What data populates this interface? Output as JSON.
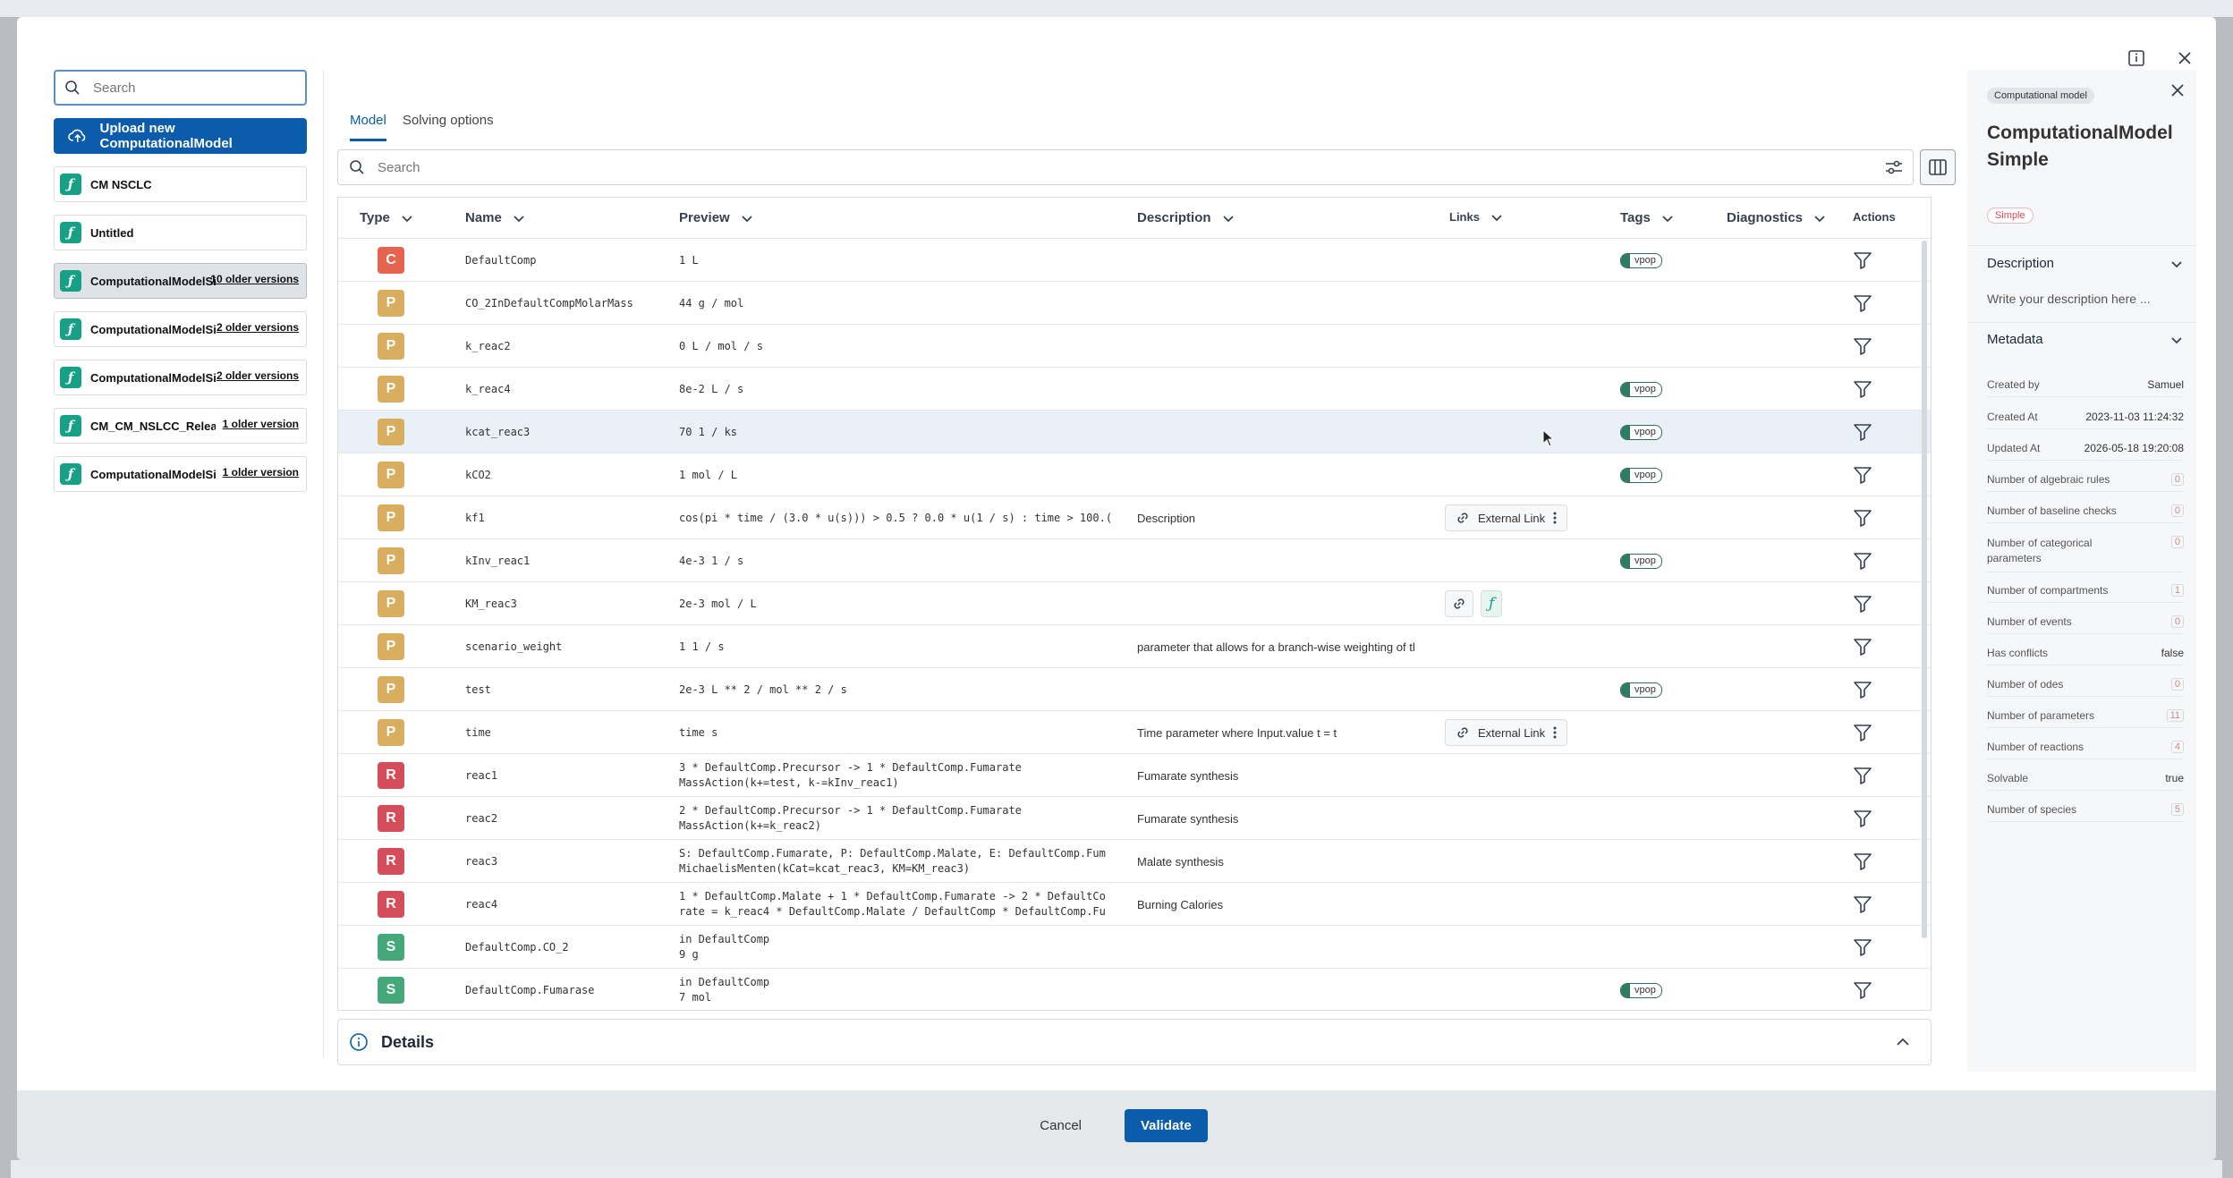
{
  "left_panel": {
    "search_placeholder": "Search",
    "upload_label": "Upload new ComputationalModel",
    "models": [
      {
        "name": "CM NSCLC",
        "versions": ""
      },
      {
        "name": "Untitled",
        "versions": ""
      },
      {
        "name": "ComputationalModelSi",
        "versions": "10 older versions"
      },
      {
        "name": "ComputationalModelSin",
        "versions": "2 older versions"
      },
      {
        "name": "ComputationalModelSin",
        "versions": "2 older versions"
      },
      {
        "name": "CM_CM_NSLCC_Release",
        "versions": "1 older version"
      },
      {
        "name": "ComputationalModelSimp",
        "versions": "1 older version"
      }
    ]
  },
  "tabs": [
    {
      "label": "Model"
    },
    {
      "label": "Solving options"
    }
  ],
  "table": {
    "search_placeholder": "Search",
    "headers": {
      "type": "Type",
      "name": "Name",
      "preview": "Preview",
      "description": "Description",
      "links": "Links",
      "tags": "Tags",
      "diagnostics": "Diagnostics",
      "actions": "Actions"
    },
    "rows": [
      {
        "type": "C",
        "name": "DefaultComp",
        "preview": [
          "1 L"
        ],
        "description": "",
        "links": "",
        "tag": "vpop"
      },
      {
        "type": "P",
        "name": "CO_2InDefaultCompMolarMass",
        "preview": [
          "44 g / mol"
        ],
        "description": "",
        "links": "",
        "tag": ""
      },
      {
        "type": "P",
        "name": "k_reac2",
        "preview": [
          "0 L / mol / s"
        ],
        "description": "",
        "links": "",
        "tag": ""
      },
      {
        "type": "P",
        "name": "k_reac4",
        "preview": [
          "8e-2 L / s"
        ],
        "description": "",
        "links": "",
        "tag": "vpop"
      },
      {
        "type": "P",
        "name": "kcat_reac3",
        "preview": [
          "70 1 / ks"
        ],
        "description": "",
        "links": "",
        "tag": "vpop"
      },
      {
        "type": "P",
        "name": "kCO2",
        "preview": [
          "1 mol / L"
        ],
        "description": "",
        "links": "",
        "tag": "vpop"
      },
      {
        "type": "P",
        "name": "kf1",
        "preview": [
          "cos(pi * time / (3.0 * u(s))) > 0.5 ? 0.0 * u(1 / s) : time > 100.("
        ],
        "description": "Description",
        "links": "External Link",
        "tag": ""
      },
      {
        "type": "P",
        "name": "kInv_reac1",
        "preview": [
          "4e-3 1 / s"
        ],
        "description": "",
        "links": "",
        "tag": "vpop"
      },
      {
        "type": "P",
        "name": "KM_reac3",
        "preview": [
          "2e-3 mol / L"
        ],
        "description": "",
        "links": "icons",
        "tag": ""
      },
      {
        "type": "P",
        "name": "scenario_weight",
        "preview": [
          "1 1 / s"
        ],
        "description": "parameter that allows for a branch-wise weighting of th",
        "links": "",
        "tag": ""
      },
      {
        "type": "P",
        "name": "test",
        "preview": [
          "2e-3 L ** 2 / mol ** 2 / s"
        ],
        "description": "",
        "links": "",
        "tag": "vpop"
      },
      {
        "type": "P",
        "name": "time",
        "preview": [
          "time s"
        ],
        "description": "Time parameter where Input.value t = t",
        "links": "External Link",
        "tag": ""
      },
      {
        "type": "R",
        "name": "reac1",
        "preview": [
          "3 * DefaultComp.Precursor -> 1 * DefaultComp.Fumarate",
          "MassAction(k+=test, k-=kInv_reac1)"
        ],
        "description": "Fumarate synthesis",
        "links": "",
        "tag": ""
      },
      {
        "type": "R",
        "name": "reac2",
        "preview": [
          "2 * DefaultComp.Precursor -> 1 * DefaultComp.Fumarate",
          "MassAction(k+=k_reac2)"
        ],
        "description": "Fumarate synthesis",
        "links": "",
        "tag": ""
      },
      {
        "type": "R",
        "name": "reac3",
        "preview": [
          "S: DefaultComp.Fumarate, P: DefaultComp.Malate, E: DefaultComp.Fum",
          "MichaelisMenten(kCat=kcat_reac3, KM=KM_reac3)"
        ],
        "description": "Malate synthesis",
        "links": "",
        "tag": ""
      },
      {
        "type": "R",
        "name": "reac4",
        "preview": [
          "1 * DefaultComp.Malate + 1 * DefaultComp.Fumarate -> 2 * DefaultCo",
          "rate = k_reac4 * DefaultComp.Malate / DefaultComp * DefaultComp.Fu"
        ],
        "description": "Burning Calories",
        "links": "",
        "tag": ""
      },
      {
        "type": "S",
        "name": "DefaultComp.CO_2",
        "preview": [
          "in DefaultComp",
          "9 g"
        ],
        "description": "",
        "links": "",
        "tag": ""
      },
      {
        "type": "S",
        "name": "DefaultComp.Fumarase",
        "preview": [
          "in DefaultComp",
          "7 mol"
        ],
        "description": "",
        "links": "",
        "tag": "vpop"
      }
    ]
  },
  "details_label": "Details",
  "right_panel": {
    "chip": "Computational model",
    "title": "ComputationalModel Simple",
    "badge": "Simple",
    "description_header": "Description",
    "description_placeholder": "Write your description here ...",
    "metadata_header": "Metadata",
    "metadata": [
      {
        "label": "Created by",
        "value": "Samuel",
        "badge": false
      },
      {
        "label": "Created At",
        "value": "2023-11-03 11:24:32",
        "badge": false
      },
      {
        "label": "Updated At",
        "value": "2026-05-18 19:20:08",
        "badge": false
      },
      {
        "label": "Number of algebraic rules",
        "value": "0",
        "badge": true
      },
      {
        "label": "Number of baseline checks",
        "value": "0",
        "badge": true
      },
      {
        "label": "Number of categorical parameters",
        "value": "0",
        "badge": true
      },
      {
        "label": "Number of compartments",
        "value": "1",
        "badge": true
      },
      {
        "label": "Number of events",
        "value": "0",
        "badge": true
      },
      {
        "label": "Has conflicts",
        "value": "false",
        "badge": false
      },
      {
        "label": "Number of odes",
        "value": "0",
        "badge": true
      },
      {
        "label": "Number of parameters",
        "value": "11",
        "badge": true
      },
      {
        "label": "Number of reactions",
        "value": "4",
        "badge": true
      },
      {
        "label": "Solvable",
        "value": "true",
        "badge": false
      },
      {
        "label": "Number of species",
        "value": "5",
        "badge": true
      }
    ]
  },
  "footer": {
    "cancel": "Cancel",
    "validate": "Validate"
  }
}
